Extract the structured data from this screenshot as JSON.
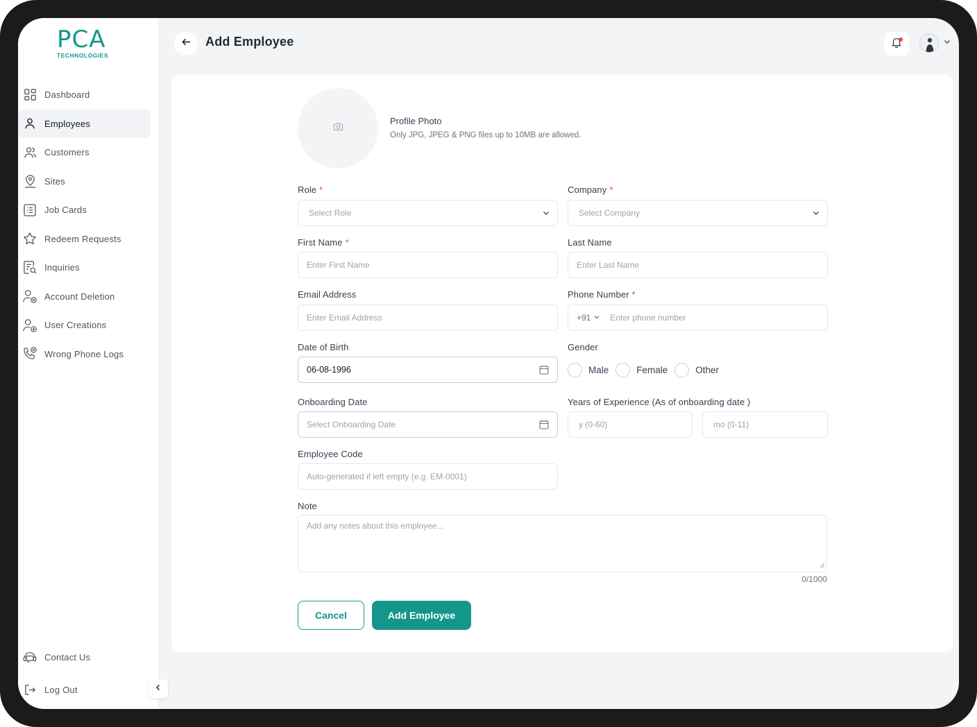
{
  "brand": {
    "logo_main": "PCA",
    "logo_sub": "TECHNOLOGIES",
    "accent_color": "#14978a"
  },
  "sidebar": {
    "items": [
      {
        "label": "Dashboard",
        "icon": "dashboard-grid-icon"
      },
      {
        "label": "Employees",
        "icon": "user-icon",
        "active": true
      },
      {
        "label": "Customers",
        "icon": "users-icon"
      },
      {
        "label": "Sites",
        "icon": "location-user-icon"
      },
      {
        "label": "Job Cards",
        "icon": "list-card-icon"
      },
      {
        "label": "Redeem Requests",
        "icon": "star-icon"
      },
      {
        "label": "Inquiries",
        "icon": "document-search-icon"
      },
      {
        "label": "Account Deletion",
        "icon": "user-remove-icon"
      },
      {
        "label": "User Creations",
        "icon": "user-add-icon"
      },
      {
        "label": "Wrong Phone Logs",
        "icon": "phone-error-icon"
      }
    ],
    "bottom": [
      {
        "label": "Contact Us",
        "icon": "support-chat-icon"
      },
      {
        "label": "Log Out",
        "icon": "logout-icon"
      }
    ]
  },
  "header": {
    "title": "Add Employee",
    "notification_dot_color": "#ef4444"
  },
  "form": {
    "photo": {
      "title": "Profile Photo",
      "hint": "Only JPG, JPEG & PNG files up to 10MB are allowed."
    },
    "role": {
      "label": "Role",
      "placeholder": "Select Role"
    },
    "company": {
      "label": "Company",
      "placeholder": "Select Company"
    },
    "first_name": {
      "label": "First Name",
      "placeholder": "Enter First Name"
    },
    "last_name": {
      "label": "Last Name",
      "placeholder": "Enter Last Name"
    },
    "email": {
      "label": "Email Address",
      "placeholder": "Enter Email Address"
    },
    "phone": {
      "label": "Phone Number",
      "country_code": "+91",
      "placeholder": "Enter phone number"
    },
    "dob": {
      "label": "Date of Birth",
      "value": "06-08-1996"
    },
    "gender": {
      "label": "Gender",
      "options": [
        "Male",
        "Female",
        "Other"
      ]
    },
    "onboarding": {
      "label": "Onboarding Date",
      "placeholder": "Select Onboarding Date"
    },
    "experience": {
      "label": "Years of Experience (As of onboarding date )",
      "years_placeholder": "y (0-60)",
      "months_placeholder": "mo (0-11)"
    },
    "employee_code": {
      "label": "Employee Code",
      "placeholder": "Auto-generated if left empty (e.g. EM-0001)"
    },
    "note": {
      "label": "Note",
      "placeholder": "Add any notes about this employee...",
      "counter": "0/1000"
    },
    "required_mark": "*"
  },
  "actions": {
    "cancel_label": "Cancel",
    "submit_label": "Add Employee"
  }
}
